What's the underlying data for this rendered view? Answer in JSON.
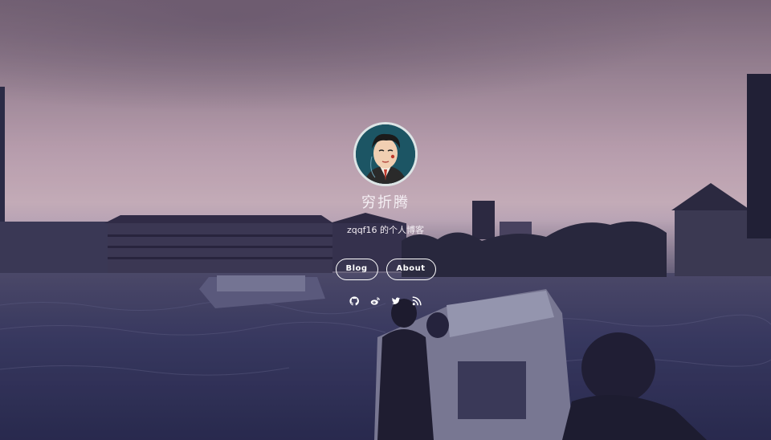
{
  "site": {
    "title": "穷折腾",
    "description": "zqqf16 的个人博客"
  },
  "nav": {
    "blog_label": "Blog",
    "about_label": "About"
  },
  "social": {
    "icons": [
      "github-icon",
      "weibo-icon",
      "twitter-icon",
      "rss-icon"
    ]
  },
  "colors": {
    "text": "#ffffff",
    "sky": "#d3bac2",
    "water": "#2d3054"
  }
}
